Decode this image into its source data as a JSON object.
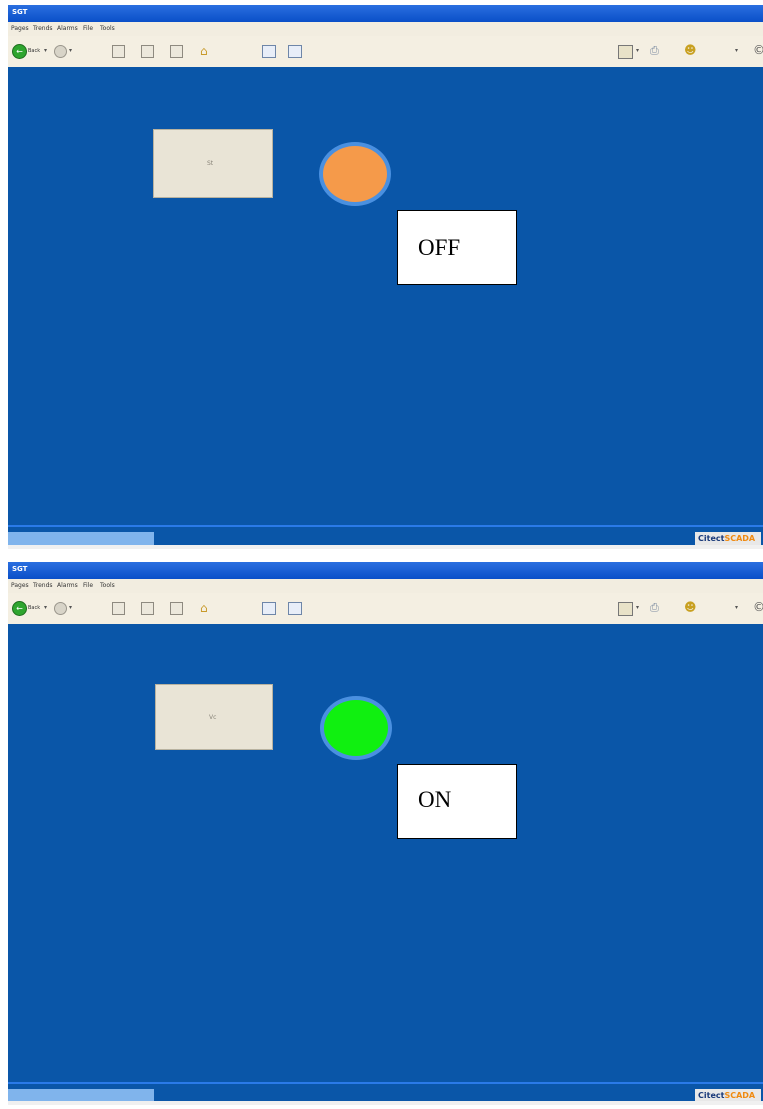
{
  "panels": [
    {
      "window_title": "SGT",
      "menu": [
        "Pages",
        "Trends",
        "Alarms",
        "File",
        "Tools"
      ],
      "toolbar": {
        "back_label": "Back"
      },
      "pushbutton_label": "St",
      "lamp_color": "#f59a4a",
      "state_text": "OFF",
      "brand": {
        "part1": "Citect",
        "part2": "SCADA"
      }
    },
    {
      "window_title": "SGT",
      "menu": [
        "Pages",
        "Trends",
        "Alarms",
        "File",
        "Tools"
      ],
      "toolbar": {
        "back_label": "Back"
      },
      "pushbutton_label": "Vc",
      "lamp_color": "#10f010",
      "state_text": "ON",
      "brand": {
        "part1": "Citect",
        "part2": "SCADA"
      }
    }
  ]
}
